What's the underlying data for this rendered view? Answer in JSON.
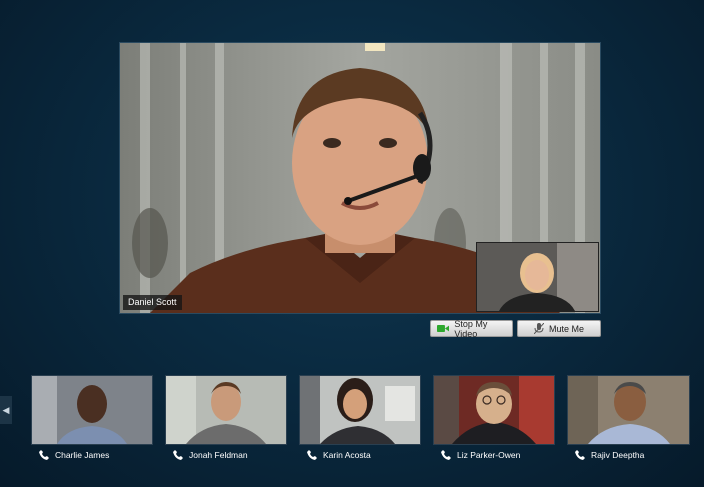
{
  "main_video": {
    "participant_name": "Daniel Scott"
  },
  "controls": {
    "stop_video_label": "Stop My Video",
    "mute_label": "Mute Me",
    "video_icon": "video-camera-icon",
    "mute_icon": "microphone-mute-icon"
  },
  "participants": [
    {
      "name": "Charlie James"
    },
    {
      "name": "Jonah Feldman"
    },
    {
      "name": "Karin Acosta"
    },
    {
      "name": "Liz Parker-Owen"
    },
    {
      "name": "Rajiv Deeptha"
    }
  ],
  "colors": {
    "accent_green": "#2da82d"
  }
}
